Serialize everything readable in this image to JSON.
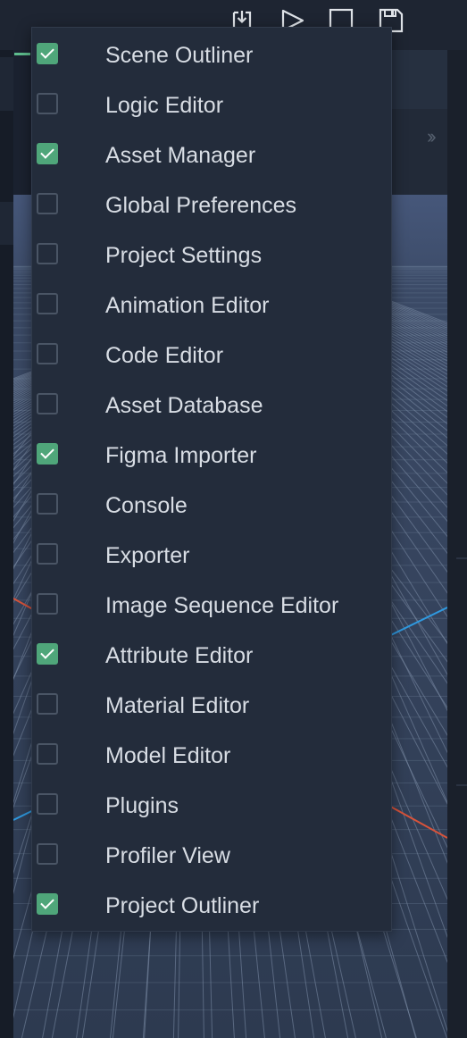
{
  "toolbar": {
    "icons": [
      "import-icon",
      "play-icon",
      "stop-icon",
      "save-icon"
    ]
  },
  "viewport": {
    "grid_color": "#7d8ea8",
    "sky_color": "#2d3a50",
    "axis_colors": {
      "x": "#d9533a",
      "z": "#2f9ae0"
    }
  },
  "panel_menu": {
    "accent": "#4fa67a",
    "items": [
      {
        "label": "Scene Outliner",
        "checked": true
      },
      {
        "label": "Logic Editor",
        "checked": false
      },
      {
        "label": "Asset Manager",
        "checked": true
      },
      {
        "label": "Global Preferences",
        "checked": false
      },
      {
        "label": "Project Settings",
        "checked": false
      },
      {
        "label": "Animation Editor",
        "checked": false
      },
      {
        "label": "Code Editor",
        "checked": false
      },
      {
        "label": "Asset Database",
        "checked": false
      },
      {
        "label": "Figma Importer",
        "checked": true
      },
      {
        "label": "Console",
        "checked": false
      },
      {
        "label": "Exporter",
        "checked": false
      },
      {
        "label": "Image Sequence Editor",
        "checked": false
      },
      {
        "label": "Attribute Editor",
        "checked": true
      },
      {
        "label": "Material Editor",
        "checked": false
      },
      {
        "label": "Model Editor",
        "checked": false
      },
      {
        "label": "Plugins",
        "checked": false
      },
      {
        "label": "Profiler View",
        "checked": false
      },
      {
        "label": "Project Outliner",
        "checked": true
      }
    ]
  }
}
